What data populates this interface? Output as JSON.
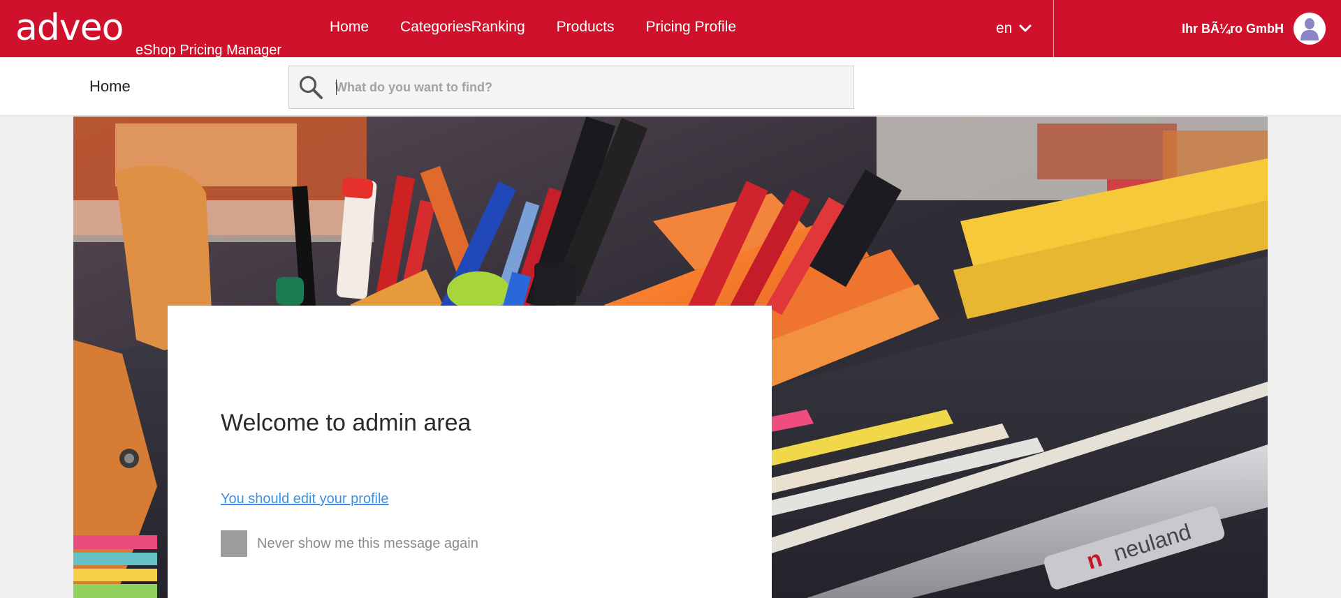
{
  "header": {
    "logo_text": "adveo",
    "tagline": "eShop Pricing Manager",
    "nav": [
      {
        "label": "Home"
      },
      {
        "label": "CategoriesRanking"
      },
      {
        "label": "Products"
      },
      {
        "label": "Pricing Profile"
      }
    ],
    "language": "en",
    "company_name": "Ihr BÃ¼ro GmbH",
    "brand_color": "#d0112b"
  },
  "subheader": {
    "page_title": "Home",
    "search": {
      "value": "",
      "placeholder": "What do you want to find?"
    }
  },
  "welcome": {
    "title": "Welcome to admin area",
    "edit_profile_link": "You should edit your profile",
    "never_show_label": "Never show me this message again",
    "never_show_checked": false
  },
  "hero": {
    "watermark_text": "neuland"
  },
  "icons": {
    "search": "magnifier-icon",
    "lang_chevron": "chevron-down-icon",
    "avatar": "user-avatar-icon"
  }
}
